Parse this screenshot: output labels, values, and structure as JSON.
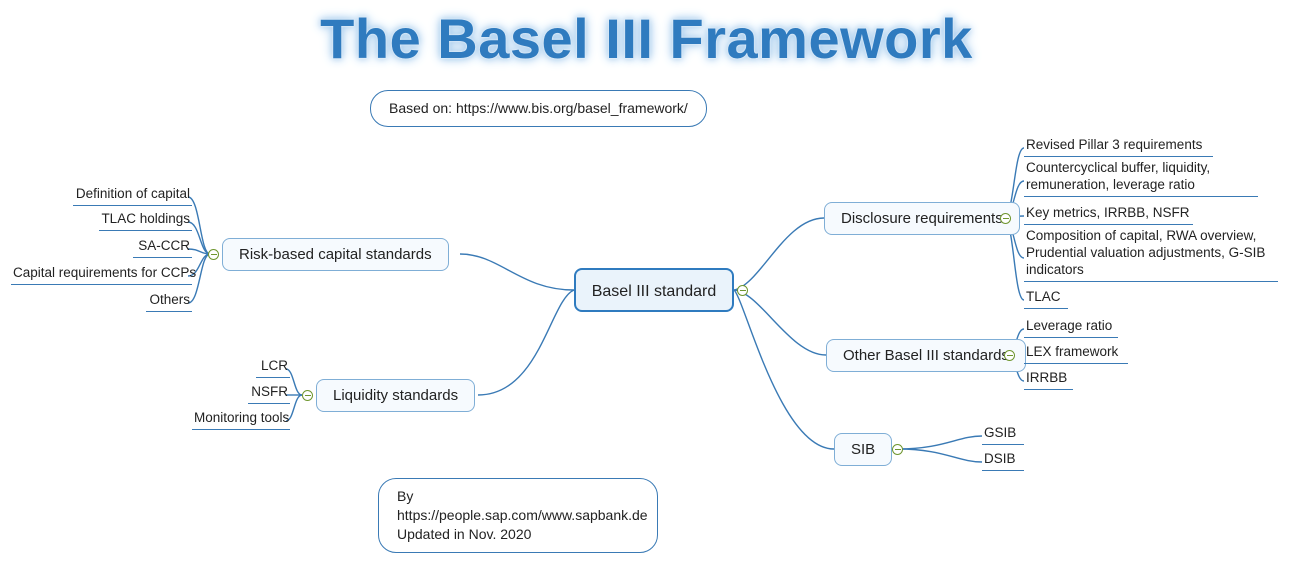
{
  "title": "The Basel III Framework",
  "subtitle": "Based on: https://www.bis.org/basel_framework/",
  "center": "Basel III standard",
  "footer_line1": "By https://people.sap.com/www.sapbank.de",
  "footer_line2": "Updated in Nov. 2020",
  "left": {
    "risk": {
      "label": "Risk-based capital standards",
      "items": [
        "Definition of capital",
        "TLAC holdings",
        "SA-CCR",
        "Capital requirements for CCPs",
        "Others"
      ]
    },
    "liquidity": {
      "label": "Liquidity standards",
      "items": [
        "LCR",
        "NSFR",
        "Monitoring tools"
      ]
    }
  },
  "right": {
    "disclosure": {
      "label": "Disclosure requirements",
      "items": [
        "Revised Pillar 3 requirements",
        "Countercyclical buffer, liquidity, remuneration, leverage ratio",
        "Key metrics, IRRBB, NSFR",
        "Composition of capital, RWA overview, Prudential valuation adjustments, G-SIB indicators",
        "TLAC"
      ]
    },
    "other": {
      "label": "Other Basel III standards",
      "items": [
        "Leverage ratio",
        "LEX framework",
        "IRRBB"
      ]
    },
    "sib": {
      "label": "SIB",
      "items": [
        "GSIB",
        "DSIB"
      ]
    }
  }
}
